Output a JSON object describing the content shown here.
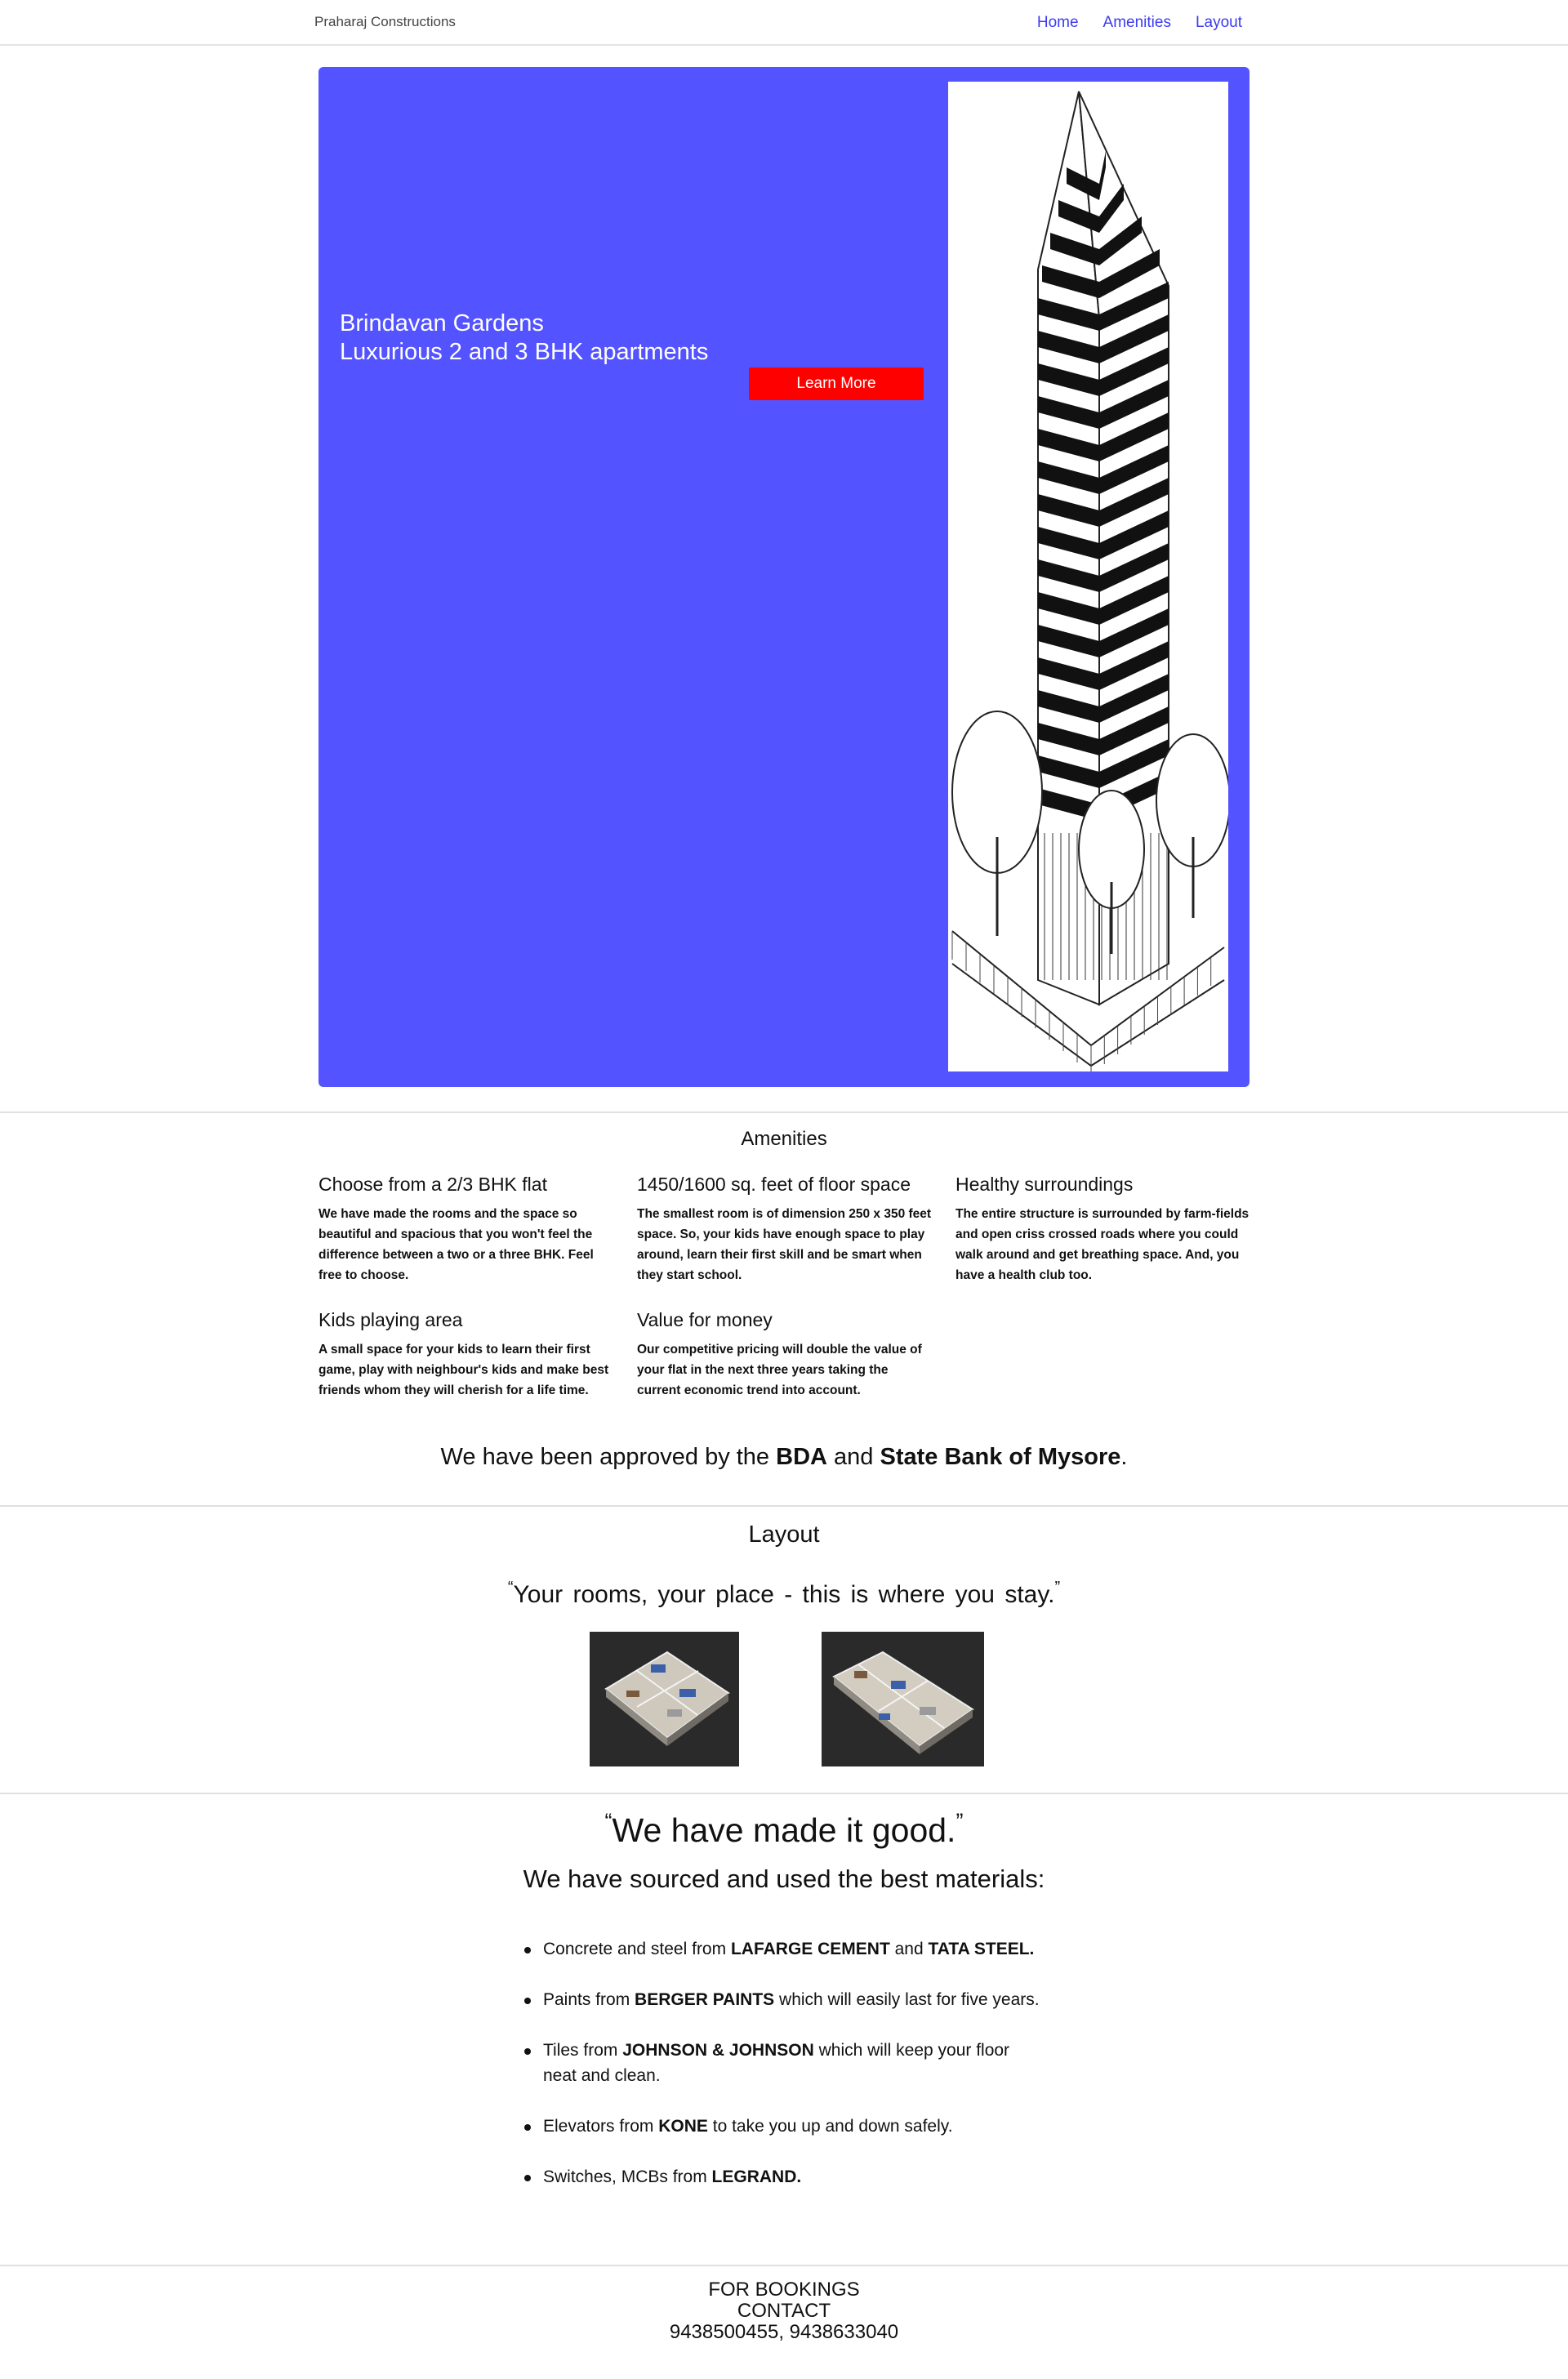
{
  "navbar": {
    "brand": "Praharaj Constructions",
    "links": [
      "Home",
      "Amenities",
      "Layout"
    ],
    "link_color": "#3b3bf0"
  },
  "hero": {
    "title_line1": "Brindavan Gardens",
    "title_line2": "Luxurious 2 and 3 BHK apartments",
    "button_label": "Learn More",
    "background_color": "#5353ff",
    "button_color": "#ff0000",
    "image": "skyscraper-sketch"
  },
  "amenities": {
    "heading": "Amenities",
    "items": [
      {
        "title": "Choose from a 2/3 BHK flat",
        "text": "We have made the rooms and the space so beautiful and spacious that you won't feel the difference between a two or a three BHK. Feel free to choose."
      },
      {
        "title": "1450/1600 sq. feet of floor space",
        "text": "The smallest room is of dimension 250 x 350 feet space. So, your kids have enough space to play around, learn their first skill and be smart when they start school."
      },
      {
        "title": "Healthy surroundings",
        "text": "The entire structure is surrounded by farm-fields and open criss crossed roads where you could walk around and get breathing space. And, you have a health club too."
      },
      {
        "title": "Kids playing area",
        "text": "A small space for your kids to learn their first game, play with neighbour's kids and make best friends whom they will cherish for a life time."
      },
      {
        "title": "Value for money",
        "text": "Our competitive pricing will double the value of your flat in the next three years taking the current economic trend into account."
      }
    ],
    "approval": {
      "prefix": "We have been approved by the",
      "org1": "BDA",
      "joiner": "and",
      "org2": "State Bank of Mysore",
      "suffix": "."
    }
  },
  "layout": {
    "heading": "Layout",
    "open_quote": "“",
    "quote": "Your rooms, your place - this is where you stay.",
    "close_quote": "”",
    "plans": [
      "floor-plan-2bhk",
      "floor-plan-3bhk"
    ]
  },
  "materials": {
    "open_quote": "“",
    "quote": "We have made it good.",
    "close_quote": "”",
    "subheading": "We have sourced and used the best materials:",
    "items": [
      {
        "pre": "Concrete and steel from ",
        "b1": "LAFARGE CEMENT",
        "mid": " and ",
        "b2": "TATA STEEL.",
        "post": ""
      },
      {
        "pre": "Paints from ",
        "b1": "BERGER PAINTS",
        "mid": " which will easily last for five years.",
        "b2": "",
        "post": ""
      },
      {
        "pre": "Tiles from ",
        "b1": "JOHNSON & JOHNSON",
        "mid": " which will keep your floor neat and clean.",
        "b2": "",
        "post": ""
      },
      {
        "pre": "Elevators from ",
        "b1": "KONE",
        "mid": " to take you up and down safely.",
        "b2": "",
        "post": ""
      },
      {
        "pre": "Switches, MCBs from ",
        "b1": "LEGRAND.",
        "mid": "",
        "b2": "",
        "post": ""
      }
    ]
  },
  "footer": {
    "line1": "FOR BOOKINGS",
    "line2": "CONTACT",
    "phones": "9438500455, 9438633040"
  }
}
